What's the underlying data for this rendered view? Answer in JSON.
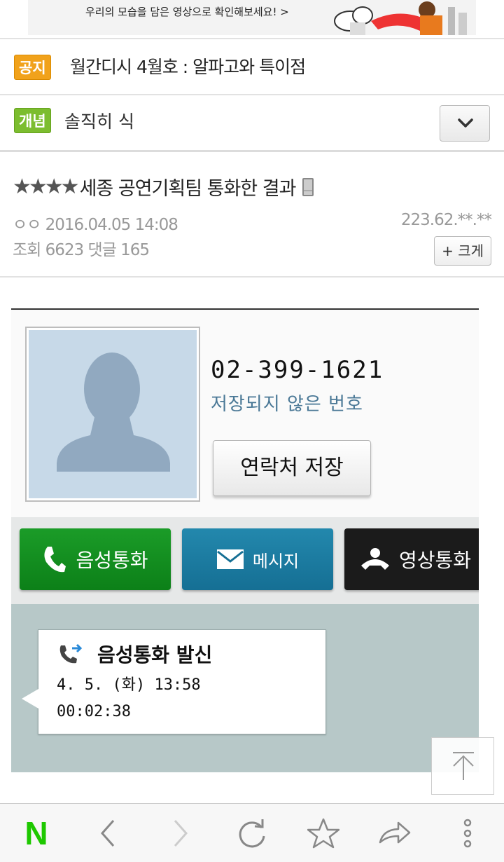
{
  "banner": {
    "text": "우리의 모습을 담은 영상으로 확인해보세요! >"
  },
  "notice": {
    "badge": "공지",
    "text": "월간디시 4월호 : 알파고와 특이점"
  },
  "category": {
    "badge": "개념",
    "text": "솔직히 식"
  },
  "post": {
    "stars": "★★★★",
    "title": "세종 공연기획팀 통화한 결과",
    "author": "ㅇㅇ 2016.04.05 14:08",
    "ip": "223.62.**.**",
    "stats": "조회 6623  댓글 165",
    "zoom_label": "+ 크게"
  },
  "call_screen": {
    "phone_number": "02-399-1621",
    "unsaved_label": "저장되지 않은 번호",
    "save_contact_label": "연락처 저장",
    "voice_call_label": "음성통화",
    "message_label": "메시지",
    "video_call_label": "영상통화",
    "log_title": "음성통화 발신",
    "log_date": "4. 5. (화) 13:58",
    "log_duration": "00:02:38"
  },
  "colors": {
    "notice_badge": "#f1a21b",
    "category_badge": "#7cbd2f",
    "voice_button": "#0c8018",
    "message_button": "#156f94",
    "video_button": "#1b1b1b",
    "log_background": "#b7c8c8",
    "naver_green": "#1ec800"
  },
  "bottom_bar": {
    "logo": "N",
    "icons": [
      "back-icon",
      "forward-icon",
      "refresh-icon",
      "star-icon",
      "share-icon",
      "more-icon"
    ]
  }
}
